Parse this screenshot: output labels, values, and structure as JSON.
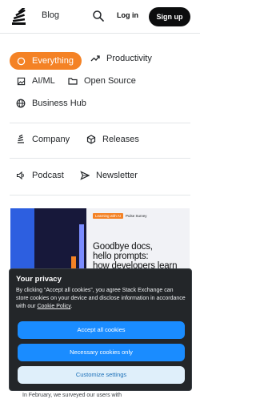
{
  "header": {
    "blog_label": "Blog",
    "login_label": "Log in",
    "signup_label": "Sign up"
  },
  "categories": [
    {
      "label": "Everything",
      "icon": "circle-icon",
      "active": true
    },
    {
      "label": "Productivity",
      "icon": "trending-up-icon"
    },
    {
      "label": "AI/ML",
      "icon": "image-icon"
    },
    {
      "label": "Open Source",
      "icon": "folder-icon"
    },
    {
      "label": "Business Hub",
      "icon": "globe-icon"
    },
    {
      "label": "Company",
      "icon": "stack-logo-icon"
    },
    {
      "label": "Releases",
      "icon": "box-icon"
    },
    {
      "label": "Podcast",
      "icon": "speaker-icon"
    },
    {
      "label": "Newsletter",
      "icon": "send-icon"
    }
  ],
  "featured": {
    "badge": "Learning with AI",
    "badge_secondary": "Pulse Survey",
    "title_line1": "Goodbye docs,",
    "title_line2": "hello prompts:",
    "title_line3": "how developers learn",
    "excerpt": "In February, we surveyed our users with"
  },
  "consent": {
    "title": "Your privacy",
    "body": "By clicking “Accept all cookies”, you agree Stack Exchange can store cookies on your device and disclose information in accordance with our ",
    "policy_link": "Cookie Policy",
    "body_end": ".",
    "accept_all": "Accept all cookies",
    "necessary_only": "Necessary cookies only",
    "customize": "Customize settings"
  },
  "colors": {
    "accent": "#f48225",
    "primary_button": "#1a8cff",
    "banner_bg": "#232629"
  }
}
